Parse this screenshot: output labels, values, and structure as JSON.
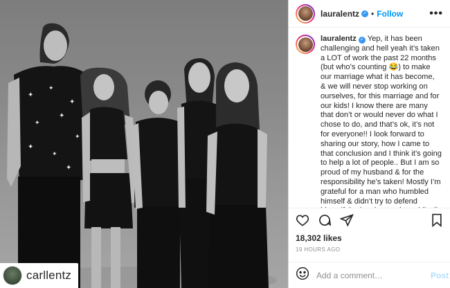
{
  "post": {
    "author": "lauralentz",
    "follow_label": "Follow",
    "separator": "•",
    "more_label": "•••",
    "caption_user": "lauralentz",
    "caption_text": "Yep, it has been challenging and hell yeah it’s taken a LOT of work the past 22 months (but who’s counting 😂) to make our marriage what it has become, & we will never stop working on ourselves, for this marriage and for our kids! I know there are many that don’t or would never do what I chose to do, and that’s ok, it’s not for everyone!! I look forward to sharing our story, how I came to that conclusion and I think it’s going to help a lot of people.. But I am so proud of my husband & for the responsibility he’s taken! Mostly I’m grateful for a man who humbled himself & didn’t try to defend himself, he has kept quiet publically and he has remained focused on the one thing that",
    "likes": "18,302 likes",
    "time": "19 HOURS AGO",
    "comment_placeholder": "Add a comment…",
    "post_label": "Post"
  },
  "photo": {
    "tagged_user": "carllentz"
  },
  "icons": {
    "verified": "✓",
    "emoji": "emoji-icon",
    "heart": "heart-icon",
    "comment": "comment-icon",
    "share": "share-icon",
    "save": "bookmark-icon"
  },
  "colors": {
    "link_blue": "#0095f6",
    "post_disabled": "#b2dffc",
    "verified_blue": "#3897f0"
  }
}
